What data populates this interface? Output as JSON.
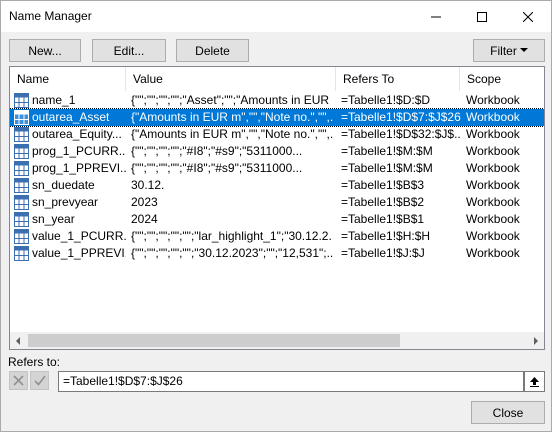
{
  "window": {
    "title": "Name Manager"
  },
  "toolbar": {
    "new_label": "New...",
    "edit_label": "Edit...",
    "delete_label": "Delete",
    "filter_label": "Filter"
  },
  "table": {
    "columns": [
      "Name",
      "Value",
      "Refers To",
      "Scope"
    ],
    "rows": [
      {
        "name": "name_1",
        "value": "{\"\";\"\";\"\";\"\";\"Asset\";\"\";\"Amounts in EUR ...",
        "refers": "=Tabelle1!$D:$D",
        "scope": "Workbook",
        "selected": false
      },
      {
        "name": "outarea_Asset",
        "value": "{\"Amounts in EUR m\",\"\",\"Note no.\",\"\",...",
        "refers": "=Tabelle1!$D$7:$J$26",
        "scope": "Workbook",
        "selected": true
      },
      {
        "name": "outarea_Equity...",
        "value": "{\"Amounts in EUR m\",\"\",\"Note no.\",\"\",...",
        "refers": "=Tabelle1!$D$32:$J$...",
        "scope": "Workbook",
        "selected": false
      },
      {
        "name": "prog_1_PCURR...",
        "value": "{\"\";\"\";\"\";\"\";\"#I8\";\"#s9\";\"5311000...",
        "refers": "=Tabelle1!$M:$M",
        "scope": "Workbook",
        "selected": false
      },
      {
        "name": "prog_1_PPREVI...",
        "value": "{\"\";\"\";\"\";\"\";\"#I8\";\"#s9\";\"5311000...",
        "refers": "=Tabelle1!$M:$M",
        "scope": "Workbook",
        "selected": false
      },
      {
        "name": "sn_duedate",
        "value": "30.12.",
        "refers": "=Tabelle1!$B$3",
        "scope": "Workbook",
        "selected": false
      },
      {
        "name": "sn_prevyear",
        "value": "2023",
        "refers": "=Tabelle1!$B$2",
        "scope": "Workbook",
        "selected": false
      },
      {
        "name": "sn_year",
        "value": "2024",
        "refers": "=Tabelle1!$B$1",
        "scope": "Workbook",
        "selected": false
      },
      {
        "name": "value_1_PCURR...",
        "value": "{\"\";\"\";\"\";\"\";\"\";\"lar_highlight_1\";\"30.12.2...",
        "refers": "=Tabelle1!$H:$H",
        "scope": "Workbook",
        "selected": false
      },
      {
        "name": "value_1_PPREVI...",
        "value": "{\"\";\"\";\"\";\"\";\"\";\"30.12.2023\";\"\";\"12,531\";...",
        "refers": "=Tabelle1!$J:$J",
        "scope": "Workbook",
        "selected": false
      }
    ]
  },
  "refers_to": {
    "label": "Refers to:",
    "value": "=Tabelle1!$D$7:$J$26"
  },
  "footer": {
    "close_label": "Close"
  },
  "colors": {
    "selection": "#0078d7",
    "dialog_bg": "#f0f0f0"
  },
  "icons": [
    "minimize-icon",
    "maximize-icon",
    "close-icon",
    "dropdown-arrow-icon",
    "name-range-icon",
    "scroll-left-icon",
    "scroll-right-icon",
    "cancel-x-icon",
    "confirm-check-icon",
    "collapse-dialog-icon"
  ]
}
